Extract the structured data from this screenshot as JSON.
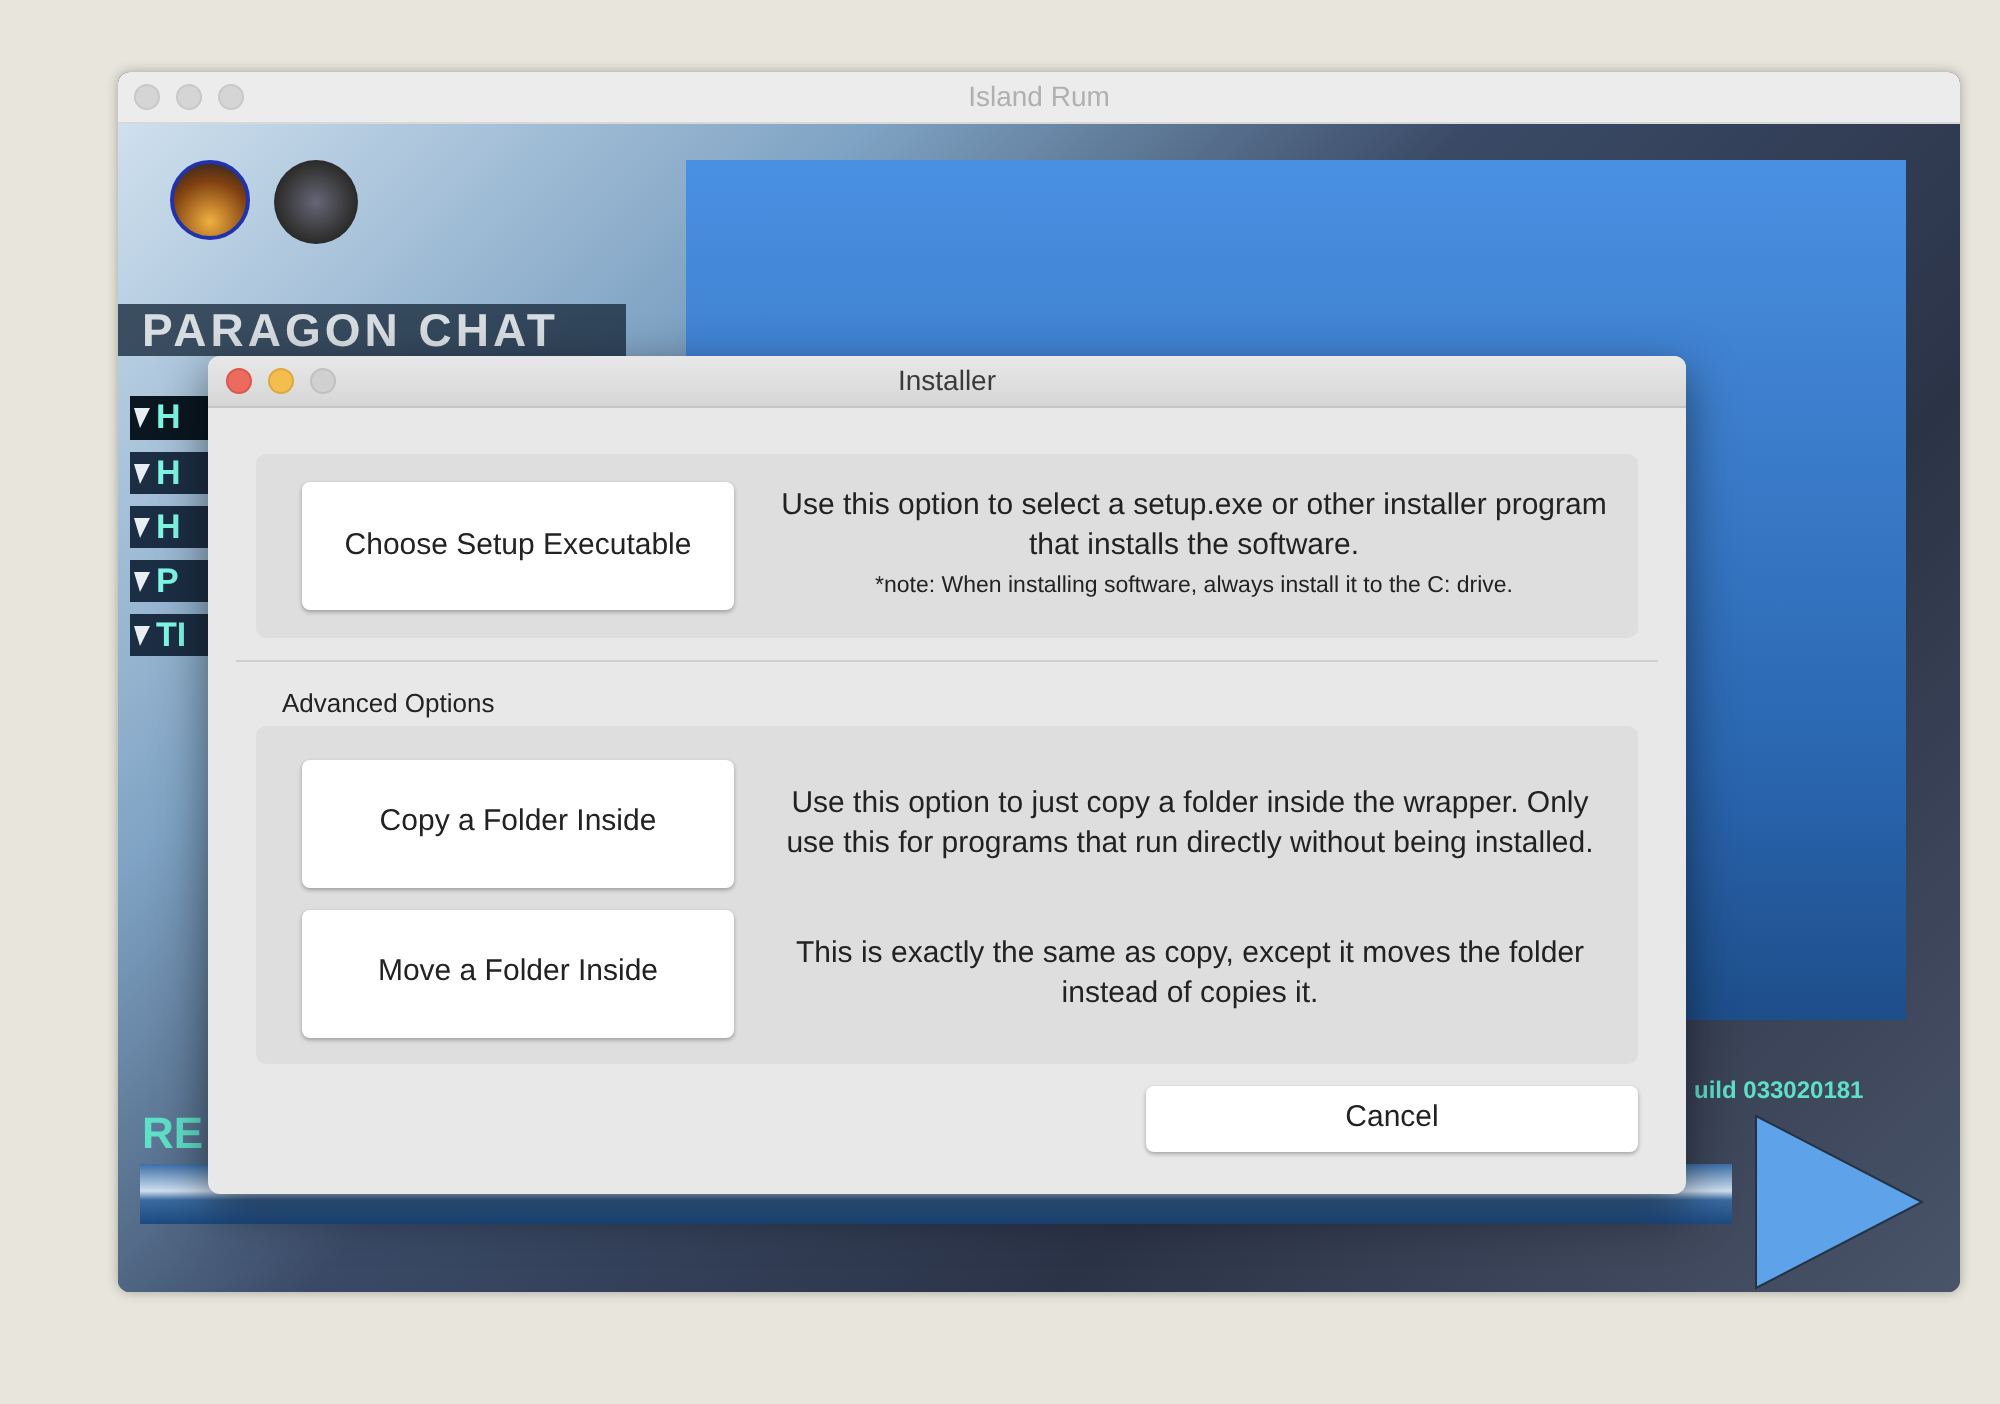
{
  "window": {
    "title": "Island Rum"
  },
  "app": {
    "logo_text": "PARAGON CHAT",
    "menu": [
      {
        "label": "H",
        "selected": true
      },
      {
        "label": "H",
        "selected": false
      },
      {
        "label": "H",
        "selected": false
      },
      {
        "label": "P",
        "selected": false
      },
      {
        "label": "TI",
        "selected": false
      }
    ],
    "footer_text": "RE",
    "build": "uild 033020181"
  },
  "dialog": {
    "title": "Installer",
    "main_option": {
      "button": "Choose Setup Executable",
      "description": "Use this option to select a setup.exe or other installer program that installs the software.",
      "note": "*note: When installing software, always install it to the C: drive."
    },
    "advanced_heading": "Advanced Options",
    "advanced_options": [
      {
        "button": "Copy a Folder Inside",
        "description": "Use this option to just copy a folder inside the wrapper. Only use this for programs that run directly without being installed."
      },
      {
        "button": "Move a Folder Inside",
        "description": "This is exactly the same as copy, except it moves the folder instead of copies it."
      }
    ],
    "cancel": "Cancel"
  }
}
